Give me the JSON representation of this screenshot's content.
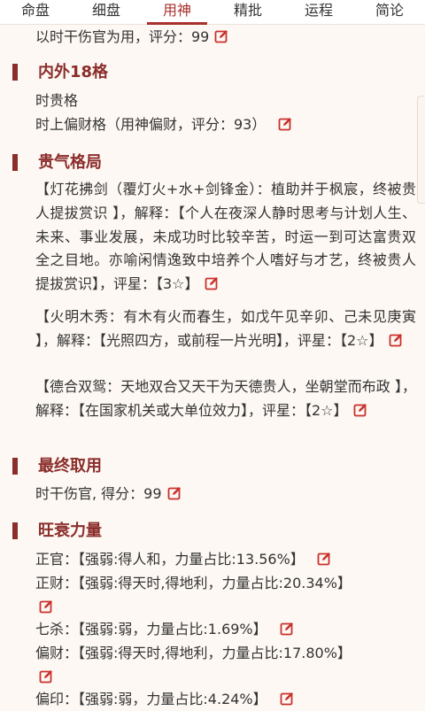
{
  "tabs": [
    {
      "label": "命盘"
    },
    {
      "label": "细盘"
    },
    {
      "label": "用神"
    },
    {
      "label": "精批"
    },
    {
      "label": "运程"
    },
    {
      "label": "简论"
    }
  ],
  "active_tab": 2,
  "top_line": "以时干伤官为用，评分：99",
  "sections": {
    "neiwai": {
      "title": "内外18格",
      "line1": "时贵格",
      "line2": "时上偏财格（用神偏财，评分：93）"
    },
    "guiqi": {
      "title": "贵气格局",
      "p1": "【灯花拂剑（覆灯火+水+剑锋金）：植助并于枫宸，终被贵人提拔赏识 】，解释：【个人在夜深人静时思考与计划人生、未来、事业发展，未成功时比较辛苦，时运一到可达富贵双全之目地。亦喻闲情逸致中培养个人嗜好与才艺，终被贵人提拔赏识】，评星：【3☆】",
      "p2": "【火明木秀：有木有火而春生，如戊午见辛卯、己未见庚寅 】，解释：【光照四方，或前程一片光明】，评星：【2☆】",
      "p3": "【德合双鸳：天地双合又天干为天德贵人，坐朝堂而布政 】，解释：【在国家机关或大单位效力】，评星：【2☆】"
    },
    "zuizhong": {
      "title": "最终取用",
      "line": "时干伤官, 得分：99"
    },
    "wangshuai": {
      "title": "旺衰力量",
      "items": [
        {
          "name": "正官：",
          "desc": "【强弱:得人和，力量占比:13.56%】"
        },
        {
          "name": "正财：",
          "desc": "【强弱:得天时,得地利，力量占比:20.34%】"
        },
        {
          "name": "七杀：",
          "desc": "【强弱:弱，力量占比:1.69%】"
        },
        {
          "name": "偏财：",
          "desc": "【强弱:得天时,得地利，力量占比:17.80%】"
        },
        {
          "name": "偏印：",
          "desc": "【强弱:弱，力量占比:4.24%】"
        }
      ]
    }
  },
  "colors": {
    "accent": "#8b2d2b",
    "active_tab": "#a8302d",
    "background": "#fdf8f3",
    "edit_icon": "#c9302c"
  }
}
